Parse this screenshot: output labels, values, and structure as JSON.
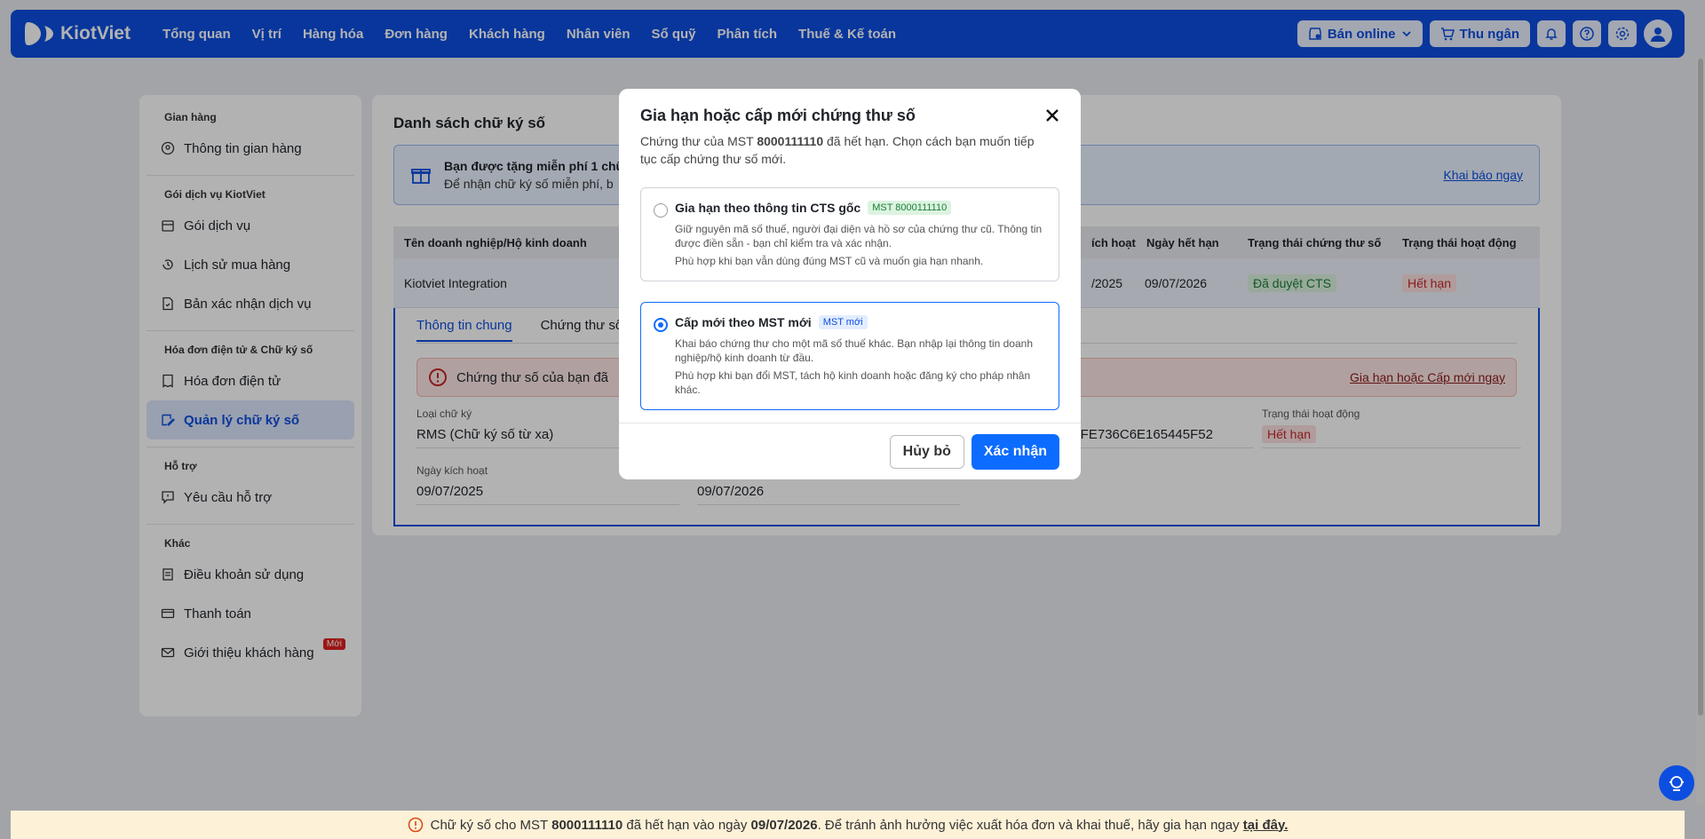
{
  "topbar": {
    "brand": "KiotViet",
    "nav": [
      "Tổng quan",
      "Vị trí",
      "Hàng hóa",
      "Đơn hàng",
      "Khách hàng",
      "Nhân viên",
      "Sổ quỹ",
      "Phân tích",
      "Thuế & Kế toán"
    ],
    "online_label": "Bán online",
    "cashier_label": "Thu ngân"
  },
  "sidebar": {
    "groups": [
      {
        "title": "Gian hàng",
        "items": [
          {
            "label": "Thông tin gian hàng",
            "icon": "user-circle-icon"
          }
        ]
      },
      {
        "title": "Gói dịch vụ KiotViet",
        "items": [
          {
            "label": "Gói dịch vụ",
            "icon": "store-icon"
          },
          {
            "label": "Lịch sử mua hàng",
            "icon": "history-icon"
          },
          {
            "label": "Bản xác nhận dịch vụ",
            "icon": "document-icon"
          }
        ]
      },
      {
        "title": "Hóa đơn điện tử & Chữ ký số",
        "items": [
          {
            "label": "Hóa đơn điện tử",
            "icon": "invoice-icon"
          },
          {
            "label": "Quản lý chữ ký số",
            "icon": "signature-icon",
            "active": true
          }
        ]
      },
      {
        "title": "Hỗ trợ",
        "items": [
          {
            "label": "Yêu cầu hỗ trợ",
            "icon": "support-icon"
          }
        ]
      },
      {
        "title": "Khác",
        "items": [
          {
            "label": "Điều khoản sử dụng",
            "icon": "terms-icon"
          },
          {
            "label": "Thanh toán",
            "icon": "card-icon"
          },
          {
            "label": "Giới thiệu khách hàng",
            "icon": "mail-icon",
            "badge": "Mới"
          }
        ]
      }
    ]
  },
  "main": {
    "title": "Danh sách chữ ký số",
    "promo_title": "Bạn được tặng miễn phí 1 chữ",
    "promo_text": "Để nhận chữ ký số miễn phí, b",
    "promo_link": "Khai báo ngay",
    "table_headers": [
      "Tên doanh nghiệp/Hộ kinh doanh",
      "ích hoạt",
      "Ngày hết hạn",
      "Trạng thái chứng thư số",
      "Trạng thái hoạt động"
    ],
    "row": {
      "name": "Kiotviet Integration",
      "activated": "/2025",
      "expires": "09/07/2026",
      "cert_status": "Đã duyệt CTS",
      "op_status": "Hết hạn"
    },
    "tabs": [
      "Thông tin chung",
      "Chứng thư số"
    ],
    "alert_text": "Chứng thư số của bạn đã",
    "alert_link": "Gia hạn hoặc Cấp mới ngay",
    "fields": {
      "sig_type_label": "Loại chữ ký",
      "sig_type_value": "RMS (Chữ ký số từ xa)",
      "serial_value": "16FE736C6E165445F52",
      "op_status_label": "Trạng thái hoạt động",
      "op_status_value": "Hết hạn",
      "activated_label": "Ngày kích hoạt",
      "activated_value": "09/07/2025",
      "expires_value": "09/07/2026"
    }
  },
  "modal": {
    "title": "Gia hạn hoặc cấp mới chứng thư số",
    "subtitle_pre": "Chứng thư của MST ",
    "subtitle_mst": "8000111110",
    "subtitle_post": " đã hết hạn. Chọn cách bạn muốn tiếp tục cấp chứng thư số mới.",
    "option1": {
      "title": "Gia hạn theo thông tin CTS gốc",
      "tag": "MST 8000111110",
      "desc": "Giữ nguyên mã số thuế, người đại diện và hồ sơ của chứng thư cũ. Thông tin được điền sẵn - bạn chỉ kiểm tra và xác nhận.",
      "note": "Phù hợp khi bạn vẫn dùng đúng MST cũ và muốn gia hạn nhanh."
    },
    "option2": {
      "title": "Cấp mới theo MST mới",
      "tag": "MST mới",
      "desc": "Khai báo chứng thư cho một mã số thuế khác. Bạn nhập lại thông tin doanh nghiệp/hộ kinh doanh từ đầu.",
      "note": "Phù hợp khi bạn đổi MST, tách hộ kinh doanh hoặc đăng ký cho pháp nhân khác."
    },
    "selected": 2,
    "cancel_label": "Hủy bỏ",
    "confirm_label": "Xác nhận"
  },
  "banner": {
    "pre": "Chữ ký số cho MST ",
    "mst": "8000111110",
    "mid": " đã hết hạn vào ngày ",
    "date": "09/07/2026",
    "post": ". Để tránh ảnh hưởng việc xuất hóa đơn và khai thuế, hãy gia hạn ngay ",
    "link": "tại đây."
  },
  "colors": {
    "brand": "#0c4ee0",
    "primary_button": "#0c6cff",
    "danger": "#c62828",
    "success": "#1a7f37"
  }
}
